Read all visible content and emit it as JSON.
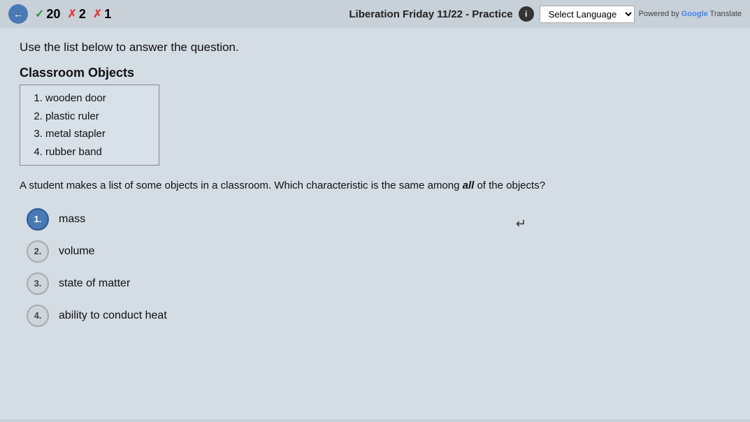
{
  "header": {
    "title": "Liberation Friday 11/22 - Practice",
    "back_label": "←",
    "info_label": "i",
    "score": {
      "check_label": "✓",
      "check_count": "20",
      "x1_label": "✗",
      "x1_count": "2",
      "x2_label": "✗",
      "x2_count": "1"
    },
    "language": {
      "select_label": "Select Language",
      "powered_by": "Powered by ",
      "google": "Google",
      "translate": " Translate"
    }
  },
  "main": {
    "instruction": "Use the list below to answer the question.",
    "list_section": {
      "title": "Classroom Objects",
      "items": [
        "wooden door",
        "plastic ruler",
        "metal stapler",
        "rubber band"
      ]
    },
    "question": "A student makes a list of some objects in a classroom. Which characteristic is the same among ",
    "question_emphasis": "all",
    "question_end": " of the objects?",
    "choices": [
      {
        "number": "1.",
        "text": "mass",
        "selected": true
      },
      {
        "number": "2.",
        "text": "volume",
        "selected": false
      },
      {
        "number": "3.",
        "text": "state of matter",
        "selected": false
      },
      {
        "number": "4.",
        "text": "ability to conduct heat",
        "selected": false
      }
    ]
  }
}
